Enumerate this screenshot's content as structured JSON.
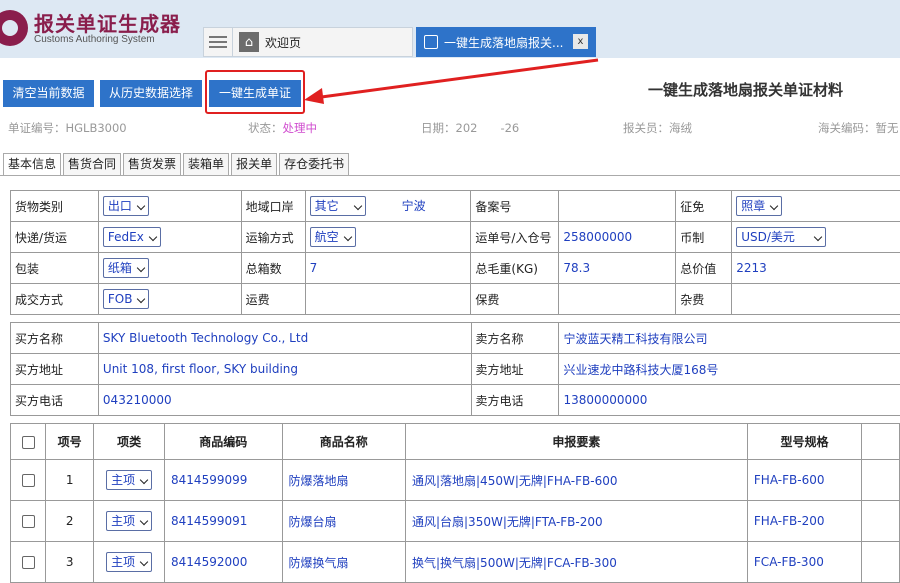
{
  "app": {
    "logo_cn": "报关单证生成器",
    "logo_en": "Customs Authoring System",
    "tab_home": "欢迎页",
    "tab_active": "一键生成落地扇报关...",
    "tab_close": "x"
  },
  "toolbar": {
    "clear_label": "清空当前数据",
    "history_label": "从历史数据选择",
    "generate_label": "一键生成单证"
  },
  "page_title": "一键生成落地扇报关单证材料",
  "meta": {
    "doc_no_label": "单证编号：",
    "doc_no": "HGLB3000",
    "status_label": "状态：",
    "status": "处理中",
    "date_label": "日期：",
    "date": "202　　-26",
    "declarant_label": "报关员：",
    "declarant": "海绒",
    "customs_code_label": "海关编码：",
    "customs_code": "暂无"
  },
  "tabs": [
    "基本信息",
    "售货合同",
    "售货发票",
    "装箱单",
    "报关单",
    "存仓委托书"
  ],
  "basic": {
    "cargo_type_label": "货物类别",
    "cargo_type": "出口",
    "port_label": "地域口岸",
    "port_select": "其它",
    "port_text": "宁波",
    "record_label": "备案号",
    "levy_label": "征免",
    "levy": "照章",
    "express_label": "快递/货运",
    "express": "FedEx",
    "transport_label": "运输方式",
    "transport": "航空",
    "waybill_label": "运单号/入仓号",
    "waybill": "258000000",
    "currency_label": "币制",
    "currency": "USD/美元",
    "pack_label": "包装",
    "pack": "纸箱",
    "boxes_label": "总箱数",
    "boxes": "7",
    "weight_label": "总毛重(KG)",
    "weight": "78.3",
    "total_label": "总价值",
    "total": "2213",
    "deal_label": "成交方式",
    "deal": "FOB",
    "freight_label": "运费",
    "insurance_label": "保费",
    "misc_label": "杂费"
  },
  "parties": {
    "buyer_name_label": "买方名称",
    "buyer_name": "SKY Bluetooth Technology Co., Ltd",
    "seller_name_label": "卖方名称",
    "seller_name": "宁波蓝天精工科技有限公司",
    "buyer_addr_label": "买方地址",
    "buyer_addr": "Unit 108, first floor, SKY building",
    "seller_addr_label": "卖方地址",
    "seller_addr": "兴业速龙中路科技大厦168号",
    "buyer_tel_label": "买方电话",
    "buyer_tel": "043210000",
    "seller_tel_label": "卖方电话",
    "seller_tel": "13800000000"
  },
  "items": {
    "headers": [
      "项号",
      "项类",
      "商品编码",
      "商品名称",
      "申报要素",
      "型号规格"
    ],
    "rows": [
      {
        "no": "1",
        "type": "主项",
        "code": "8414599099",
        "name": "防爆落地扇",
        "elements": "通风|落地扇|450W|无牌|FHA-FB-600",
        "model": "FHA-FB-600"
      },
      {
        "no": "2",
        "type": "主项",
        "code": "8414599091",
        "name": "防爆台扇",
        "elements": "通风|台扇|350W|无牌|FTA-FB-200",
        "model": "FHA-FB-200"
      },
      {
        "no": "3",
        "type": "主项",
        "code": "8414592000",
        "name": "防爆换气扇",
        "elements": "换气|换气扇|500W|无牌|FCA-FB-300",
        "model": "FCA-FB-300"
      }
    ]
  },
  "colors": {
    "accent": "#2e73c9",
    "brand": "#8a1e4c",
    "highlight": "#e02020",
    "status": "#d04ccf",
    "value_text": "#1f3fbf"
  }
}
